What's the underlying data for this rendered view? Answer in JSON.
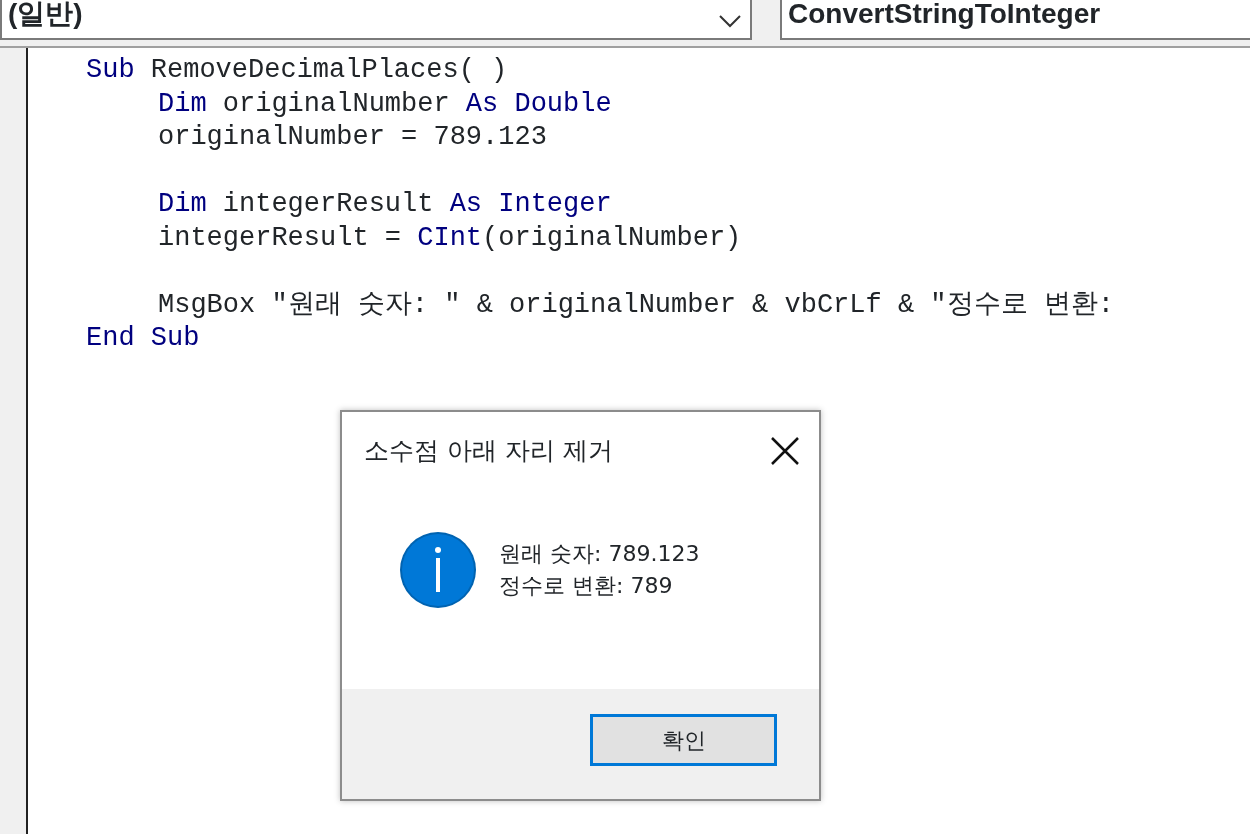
{
  "toolbar": {
    "object_combo": {
      "value": "(일반)"
    },
    "procedure_combo": {
      "value": "ConvertStringToInteger"
    }
  },
  "code": [
    {
      "kind": "line",
      "tokens": [
        {
          "text": "Sub",
          "kind": "keyword"
        },
        {
          "text": " RemoveDecimalPlaces( )",
          "kind": "plain"
        }
      ],
      "children": [
        {
          "kind": "line",
          "tokens": [
            {
              "text": "Dim",
              "kind": "keyword"
            },
            {
              "text": " originalNumber ",
              "kind": "plain"
            },
            {
              "text": "As Double",
              "kind": "keyword"
            }
          ]
        },
        {
          "kind": "line",
          "tokens": [
            {
              "text": "originalNumber = 789.123",
              "kind": "plain"
            }
          ]
        },
        {
          "kind": "blank"
        },
        {
          "kind": "line",
          "tokens": [
            {
              "text": "Dim",
              "kind": "keyword"
            },
            {
              "text": " integerResult ",
              "kind": "plain"
            },
            {
              "text": "As Integer",
              "kind": "keyword"
            }
          ]
        },
        {
          "kind": "line",
          "tokens": [
            {
              "text": "integerResult = ",
              "kind": "plain"
            },
            {
              "text": "CInt",
              "kind": "keyword"
            },
            {
              "text": "(originalNumber)",
              "kind": "plain"
            }
          ]
        },
        {
          "kind": "blank"
        },
        {
          "kind": "line",
          "tokens": [
            {
              "text": "MsgBox \"원래 숫자: \" & originalNumber & vbCrLf & \"정수로 변환:",
              "kind": "plain"
            }
          ]
        }
      ]
    },
    {
      "kind": "line",
      "tokens": [
        {
          "text": "End Sub",
          "kind": "keyword"
        }
      ]
    }
  ],
  "dialog": {
    "title": "소수점 아래 자리 제거",
    "kind": "info",
    "message": [
      "원래 숫자: 789.123",
      "정수로 변환: 789"
    ],
    "buttons": [
      {
        "label": "확인",
        "focused": true
      }
    ]
  }
}
